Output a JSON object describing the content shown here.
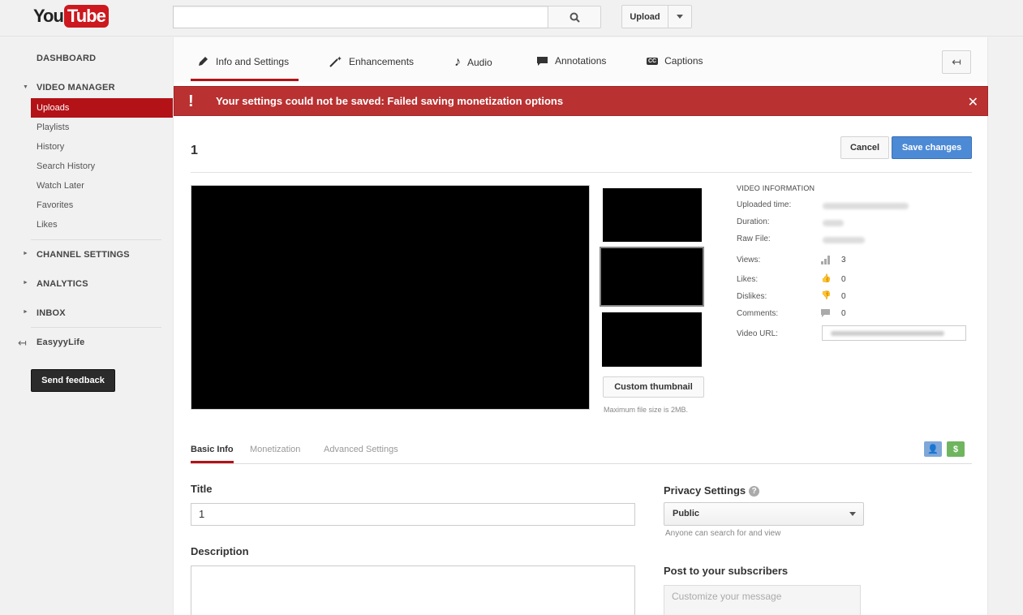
{
  "header": {
    "logo_you": "You",
    "logo_tube": "Tube",
    "search_placeholder": "",
    "upload_label": "Upload"
  },
  "sidebar": {
    "dashboard": "DASHBOARD",
    "video_manager": "VIDEO MANAGER",
    "items": [
      "Uploads",
      "Playlists",
      "History",
      "Search History",
      "Watch Later",
      "Favorites",
      "Likes"
    ],
    "channel_settings": "CHANNEL SETTINGS",
    "analytics": "ANALYTICS",
    "inbox": "INBOX",
    "channel_name": "EasyyyLife",
    "feedback": "Send feedback"
  },
  "tabs": {
    "info": "Info and Settings",
    "enhancements": "Enhancements",
    "audio": "Audio",
    "annotations": "Annotations",
    "captions": "Captions"
  },
  "error": {
    "message": "Your settings could not be saved: Failed saving monetization options"
  },
  "video": {
    "title": "1",
    "cancel": "Cancel",
    "save": "Save changes",
    "custom_thumbnail": "Custom thumbnail",
    "max_size": "Maximum file size is 2MB."
  },
  "info": {
    "heading": "VIDEO INFORMATION",
    "uploaded_label": "Uploaded time:",
    "duration_label": "Duration:",
    "raw_file_label": "Raw File:",
    "views_label": "Views:",
    "views": "3",
    "likes_label": "Likes:",
    "likes": "0",
    "dislikes_label": "Dislikes:",
    "dislikes": "0",
    "comments_label": "Comments:",
    "comments": "0",
    "url_label": "Video URL:"
  },
  "subtabs": {
    "basic": "Basic Info",
    "monetization": "Monetization",
    "advanced": "Advanced Settings"
  },
  "form": {
    "title_label": "Title",
    "title_value": "1",
    "description_label": "Description",
    "privacy_label": "Privacy Settings",
    "privacy_value": "Public",
    "privacy_hint": "Anyone can search for and view",
    "post_label": "Post to your subscribers",
    "post_placeholder": "Customize your message"
  },
  "colors": {
    "accent_red": "#b31217",
    "error_red": "#b93131",
    "save_blue": "#4d8ad5"
  }
}
